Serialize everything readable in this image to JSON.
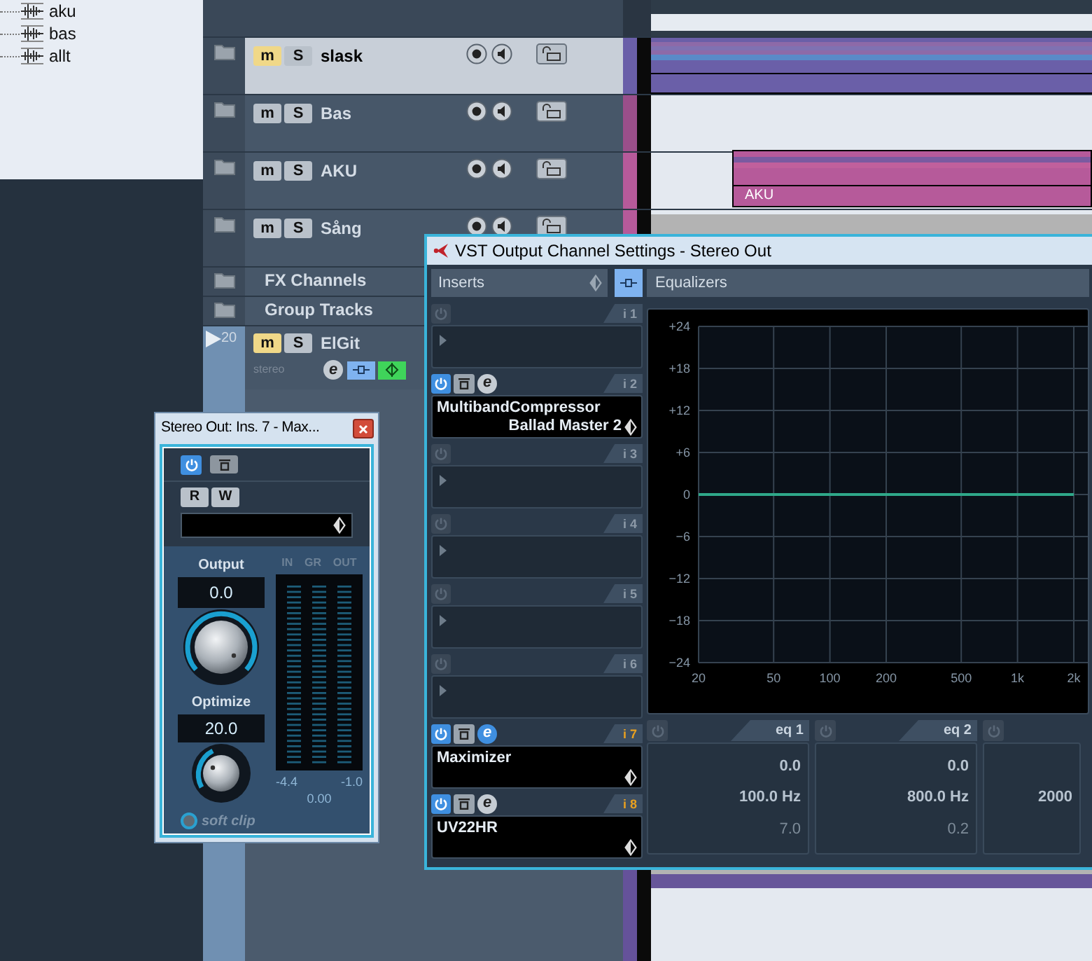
{
  "tree": {
    "items": [
      {
        "label": "aku"
      },
      {
        "label": "bas"
      },
      {
        "label": "allt"
      }
    ]
  },
  "tracks": [
    {
      "kind": "audio",
      "name": "slask",
      "selected": true,
      "muted": true,
      "mute_label": "m",
      "solo_label": "S",
      "color": "#6a5fa8",
      "lane": {
        "kind": "event"
      }
    },
    {
      "kind": "audio",
      "name": "Bas",
      "selected": false,
      "muted": false,
      "mute_label": "m",
      "solo_label": "S",
      "color": "#9a4f8a",
      "lane": {
        "kind": "empty"
      }
    },
    {
      "kind": "audio",
      "name": "AKU",
      "selected": false,
      "muted": false,
      "mute_label": "m",
      "solo_label": "S",
      "color": "#b65a9a",
      "lane": {
        "kind": "event",
        "label": "AKU"
      }
    },
    {
      "kind": "audio",
      "name": "Sång",
      "selected": false,
      "muted": false,
      "mute_label": "m",
      "solo_label": "S",
      "color": "#b65a9a",
      "lane": {
        "kind": "gray"
      }
    },
    {
      "kind": "folder",
      "name": "FX Channels",
      "selected": false
    },
    {
      "kind": "folder",
      "name": "Group Tracks",
      "selected": false
    },
    {
      "kind": "instrument",
      "name": "ElGit",
      "number": "20",
      "sublabel": "stereo",
      "edit_label": "e",
      "selected": false,
      "muted": true,
      "mute_label": "m",
      "solo_label": "S"
    }
  ],
  "maximizer": {
    "title": "Stereo Out: Ins. 7 - Max...",
    "power_on": true,
    "automation_buttons": [
      "R",
      "W"
    ],
    "output_label": "Output",
    "output_value": "0.0",
    "optimize_label": "Optimize",
    "optimize_value": "20.0",
    "meter_labels": [
      "IN",
      "GR",
      "OUT"
    ],
    "reading_in": "-4.4",
    "reading_gr": "0.00",
    "reading_out": "-1.0",
    "soft_clip_label": "soft clip",
    "soft_clip_on": false
  },
  "channel_window": {
    "title": "VST Output Channel Settings - Stereo Out",
    "inserts_tab": "Inserts",
    "equalizers_tab": "Equalizers",
    "inserts": [
      {
        "label": "i 1",
        "on": false,
        "post_fader": false
      },
      {
        "label": "i 2",
        "on": true,
        "post_fader": false,
        "plugin": "MultibandCompressor",
        "preset": "Ballad Master 2",
        "edit_label": "e",
        "editor_open": false
      },
      {
        "label": "i 3",
        "on": false,
        "post_fader": false
      },
      {
        "label": "i 4",
        "on": false,
        "post_fader": false
      },
      {
        "label": "i 5",
        "on": false,
        "post_fader": false
      },
      {
        "label": "i 6",
        "on": false,
        "post_fader": false
      },
      {
        "label": "i 7",
        "on": true,
        "post_fader": true,
        "plugin": "Maximizer",
        "edit_label": "e",
        "editor_open": true
      },
      {
        "label": "i 8",
        "on": true,
        "post_fader": true,
        "plugin": "UV22HR",
        "edit_label": "e",
        "editor_open": false
      }
    ],
    "chart_data": {
      "type": "line",
      "categories": [
        "20",
        null,
        null,
        null,
        "50",
        null,
        null,
        "100",
        null,
        null,
        "200",
        null,
        null,
        null,
        "500",
        null,
        null,
        "1k",
        null,
        null,
        "2k"
      ],
      "series": [
        {
          "color": "#2fa889",
          "values": [
            0,
            0,
            0,
            0,
            0,
            0,
            0,
            0,
            0,
            0,
            0,
            0,
            0,
            0,
            0,
            0,
            0,
            0,
            0,
            0,
            0
          ]
        }
      ],
      "ylim": [
        -24,
        24
      ],
      "grid": true,
      "yticks": [
        {
          "value": 24,
          "label": "+24"
        },
        {
          "value": 18,
          "label": "+18"
        },
        {
          "value": 12,
          "label": "+12"
        },
        {
          "value": 6,
          "label": "+6"
        },
        {
          "value": 0,
          "label": "0"
        },
        {
          "value": -6,
          "label": "−6"
        },
        {
          "value": -12,
          "label": "−12"
        },
        {
          "value": -18,
          "label": "−18"
        },
        {
          "value": -24,
          "label": "−24"
        }
      ]
    },
    "bands": [
      {
        "label": "eq 1",
        "on": false,
        "gain": "0.0",
        "frequency": "100.0 Hz",
        "q": "7.0"
      },
      {
        "label": "eq 2",
        "on": false,
        "gain": "0.0",
        "frequency": "800.0 Hz",
        "q": "0.2"
      },
      {
        "on": false,
        "frequency": "2000"
      }
    ]
  }
}
